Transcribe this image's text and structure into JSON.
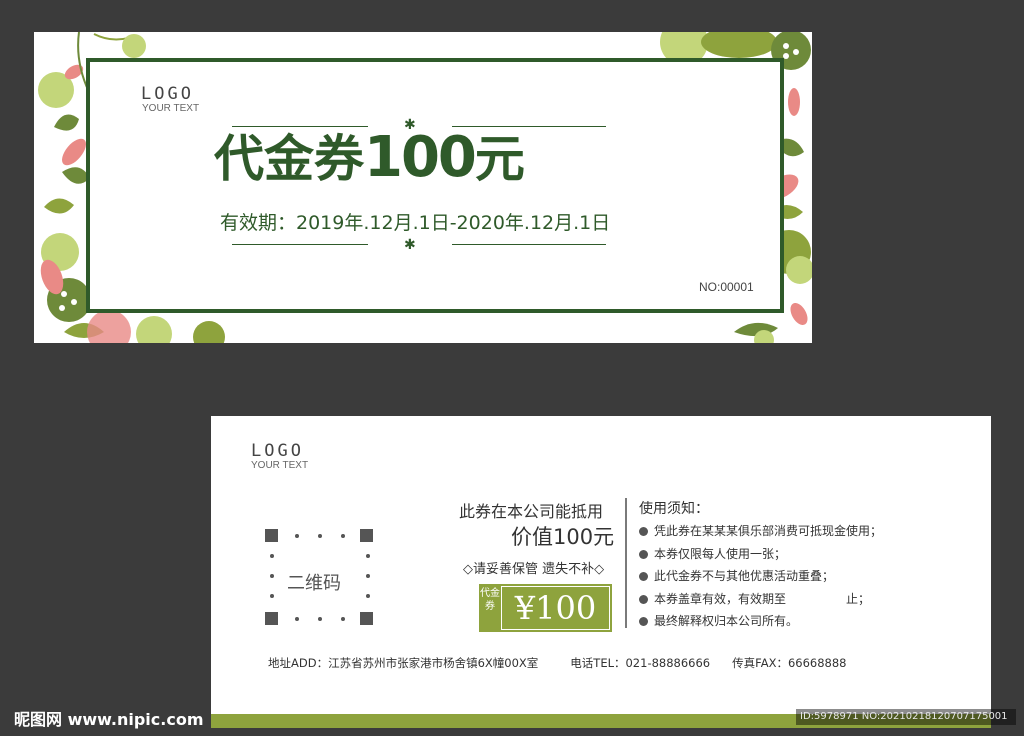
{
  "front": {
    "logo_title": "LOGO",
    "logo_sub": "YOUR TEXT",
    "title_prefix": "代金券",
    "title_amount": "100",
    "title_suffix": "元",
    "validity": "有效期：2019年.12月.1日-2020年.12月.1日",
    "serial": "NO:00001"
  },
  "back": {
    "logo_title": "LOGO",
    "logo_sub": "YOUR TEXT",
    "qr_label": "二维码",
    "use_line": "此券在本公司能抵用",
    "value_line": "价值100元",
    "keep_line": "◇请妥善保管 遗失不补◇",
    "badge_left": "代金券",
    "badge_amount": "¥100",
    "notes_title": "使用须知：",
    "notes": [
      "凭此券在某某某俱乐部消费可抵现金使用；",
      "本券仅限每人使用一张；",
      "此代金券不与其他优惠活动重叠；",
      "本券盖章有效，有效期至　　　　　止；",
      "最终解释权归本公司所有。"
    ],
    "address": "地址ADD：江苏省苏州市张家港市杨舍镇6X幢00X室",
    "phone": "电话TEL：021-88886666",
    "fax": "传真FAX：66668888"
  },
  "watermark": {
    "site": "昵图网 www.nipic.com",
    "id": "ID:5978971 NO:20210218120707175001"
  },
  "colors": {
    "dark_green": "#2f5a2a",
    "light_green": "#c3d67a",
    "olive": "#8ea33d",
    "pink": "#e98a86",
    "background": "#3b3b3b"
  }
}
